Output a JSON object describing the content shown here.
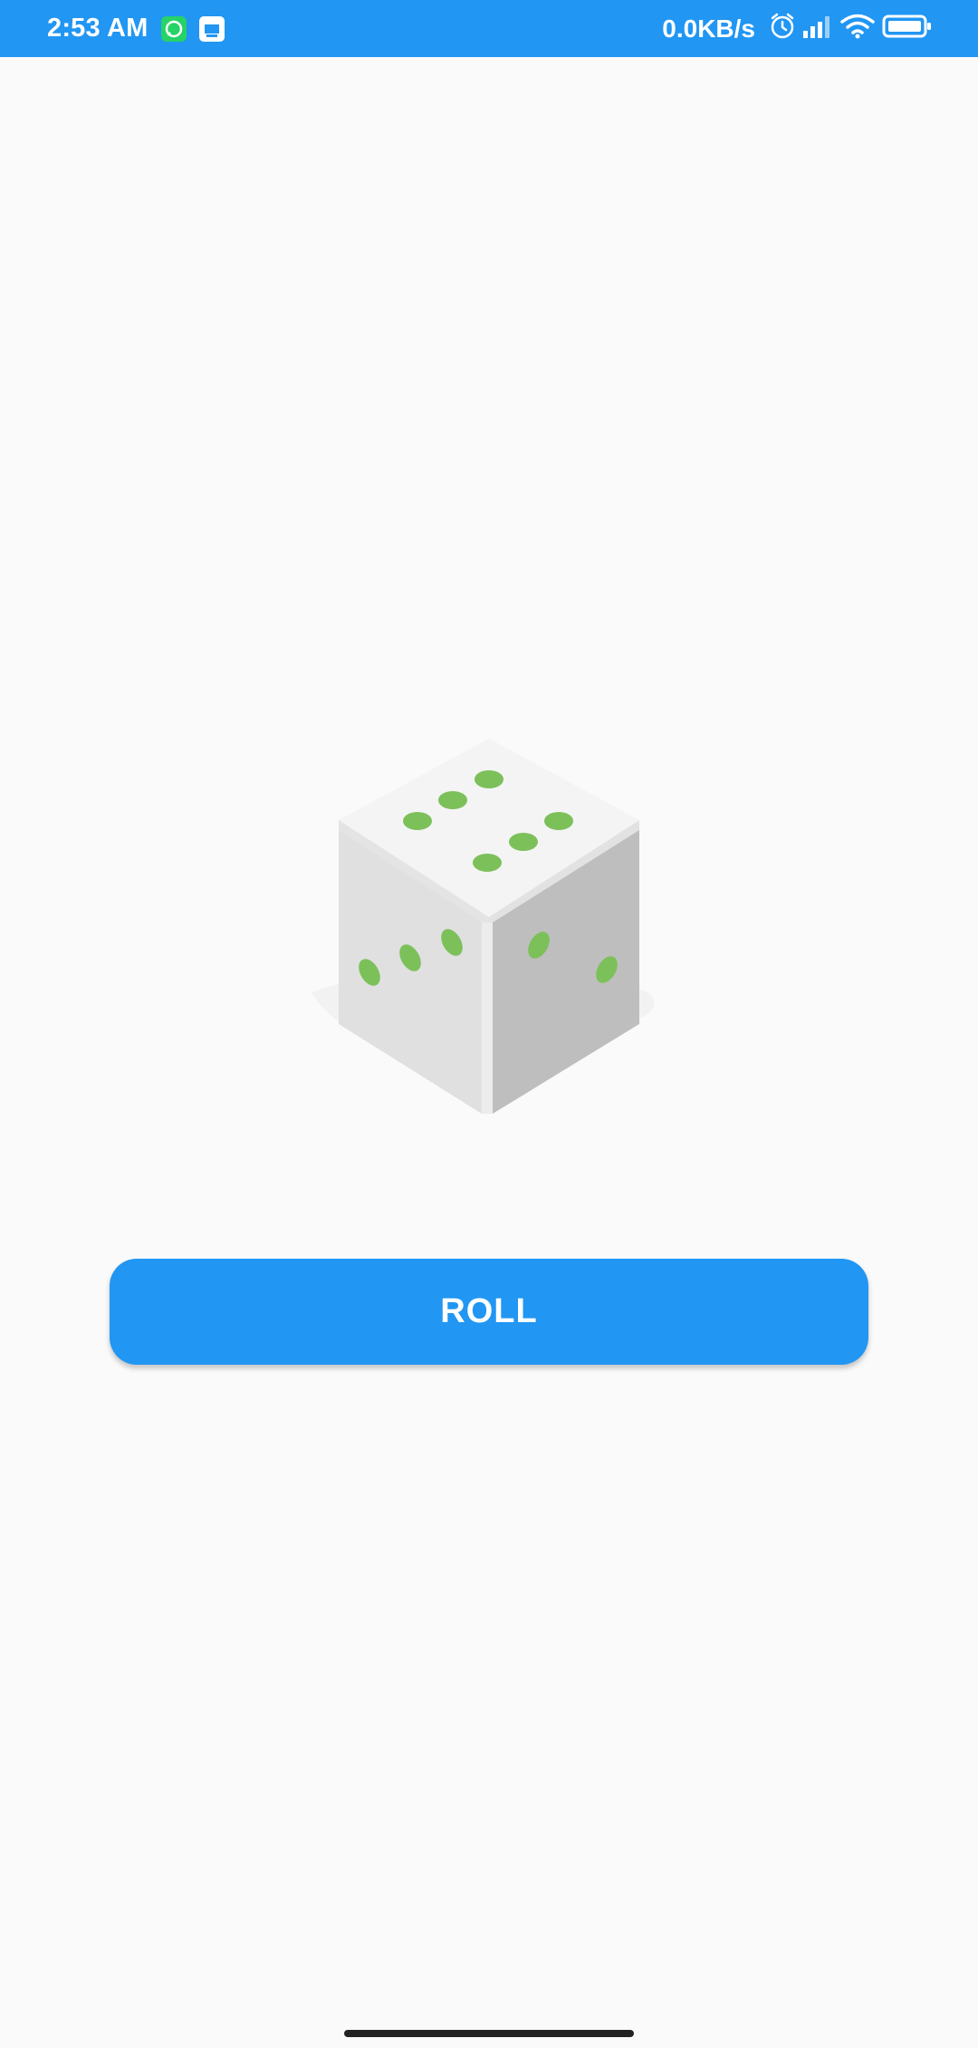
{
  "status_bar": {
    "time": "2:53 AM",
    "net_speed": "0.0KB/s",
    "background_color": "#2196f3",
    "left_icons": [
      "whatsapp-icon",
      "app-notification-icon"
    ],
    "right_icons": [
      "alarm-icon",
      "signal-icon",
      "wifi-icon",
      "battery-icon"
    ]
  },
  "dice": {
    "top_face_value": 6,
    "left_face_value": 3,
    "right_face_value": 2,
    "pip_color": "#7cc05a"
  },
  "roll_button": {
    "label": "ROLL",
    "color": "#2196f3"
  }
}
